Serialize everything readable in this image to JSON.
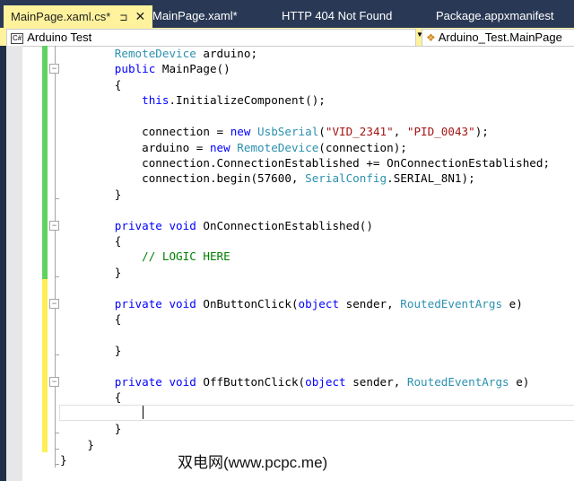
{
  "tabs": [
    {
      "label": "MainPage.xaml.cs*",
      "active": true
    },
    {
      "label": "MainPage.xaml*"
    },
    {
      "label": "HTTP 404 Not Found"
    },
    {
      "label": "Package.appxmanifest"
    }
  ],
  "tab_pin": "⊐",
  "tab_close": "✕",
  "navbar": {
    "project_icon": "C#",
    "project": "Arduino Test",
    "member": "Arduino_Test.MainPage"
  },
  "code": [
    [
      [
        "ty",
        "RemoteDevice"
      ],
      [
        "tx",
        " arduino;"
      ]
    ],
    [
      [
        "kw",
        "public"
      ],
      [
        "tx",
        " MainPage()"
      ]
    ],
    [
      [
        "tx",
        "{"
      ]
    ],
    [
      [
        "th",
        "    this"
      ],
      [
        "tx",
        ".InitializeComponent();"
      ]
    ],
    [],
    [
      [
        "tx",
        "    connection = "
      ],
      [
        "kw",
        "new"
      ],
      [
        "tx",
        " "
      ],
      [
        "ty",
        "UsbSerial"
      ],
      [
        "tx",
        "("
      ],
      [
        "st",
        "\"VID_2341\""
      ],
      [
        "tx",
        ", "
      ],
      [
        "st",
        "\"PID_0043\""
      ],
      [
        "tx",
        ");"
      ]
    ],
    [
      [
        "tx",
        "    arduino = "
      ],
      [
        "kw",
        "new"
      ],
      [
        "tx",
        " "
      ],
      [
        "ty",
        "RemoteDevice"
      ],
      [
        "tx",
        "(connection);"
      ]
    ],
    [
      [
        "tx",
        "    connection.ConnectionEstablished += OnConnectionEstablished;"
      ]
    ],
    [
      [
        "tx",
        "    connection.begin(57600, "
      ],
      [
        "ty",
        "SerialConfig"
      ],
      [
        "tx",
        ".SERIAL_8N1);"
      ]
    ],
    [
      [
        "tx",
        "}"
      ]
    ],
    [],
    [
      [
        "kw",
        "private"
      ],
      [
        "tx",
        " "
      ],
      [
        "kw",
        "void"
      ],
      [
        "tx",
        " OnConnectionEstablished()"
      ]
    ],
    [
      [
        "tx",
        "{"
      ]
    ],
    [
      [
        "cm",
        "    // LOGIC HERE"
      ]
    ],
    [
      [
        "tx",
        "}"
      ]
    ],
    [],
    [
      [
        "kw",
        "private"
      ],
      [
        "tx",
        " "
      ],
      [
        "kw",
        "void"
      ],
      [
        "tx",
        " OnButtonClick("
      ],
      [
        "kw",
        "object"
      ],
      [
        "tx",
        " sender, "
      ],
      [
        "ty",
        "RoutedEventArgs"
      ],
      [
        "tx",
        " e)"
      ]
    ],
    [
      [
        "tx",
        "{"
      ]
    ],
    [],
    [
      [
        "tx",
        "}"
      ]
    ],
    [],
    [
      [
        "kw",
        "private"
      ],
      [
        "tx",
        " "
      ],
      [
        "kw",
        "void"
      ],
      [
        "tx",
        " OffButtonClick("
      ],
      [
        "kw",
        "object"
      ],
      [
        "tx",
        " sender, "
      ],
      [
        "ty",
        "RoutedEventArgs"
      ],
      [
        "tx",
        " e)"
      ]
    ],
    [
      [
        "tx",
        "{"
      ]
    ],
    [],
    [
      [
        "tx",
        "}"
      ]
    ],
    [
      [
        "tx",
        "}"
      ]
    ],
    [
      [
        "tx",
        "}"
      ]
    ]
  ],
  "indents": [
    8,
    8,
    8,
    8,
    8,
    8,
    8,
    8,
    8,
    8,
    8,
    8,
    8,
    8,
    8,
    8,
    8,
    8,
    8,
    8,
    8,
    8,
    8,
    8,
    8,
    4,
    0
  ],
  "watermark": "双电网(www.pcpc.me)",
  "colors": {
    "tab_bg": "#293955",
    "active": "#fff29d",
    "saved_change": "#5fd35f",
    "unsaved_change": "#ffee55"
  }
}
